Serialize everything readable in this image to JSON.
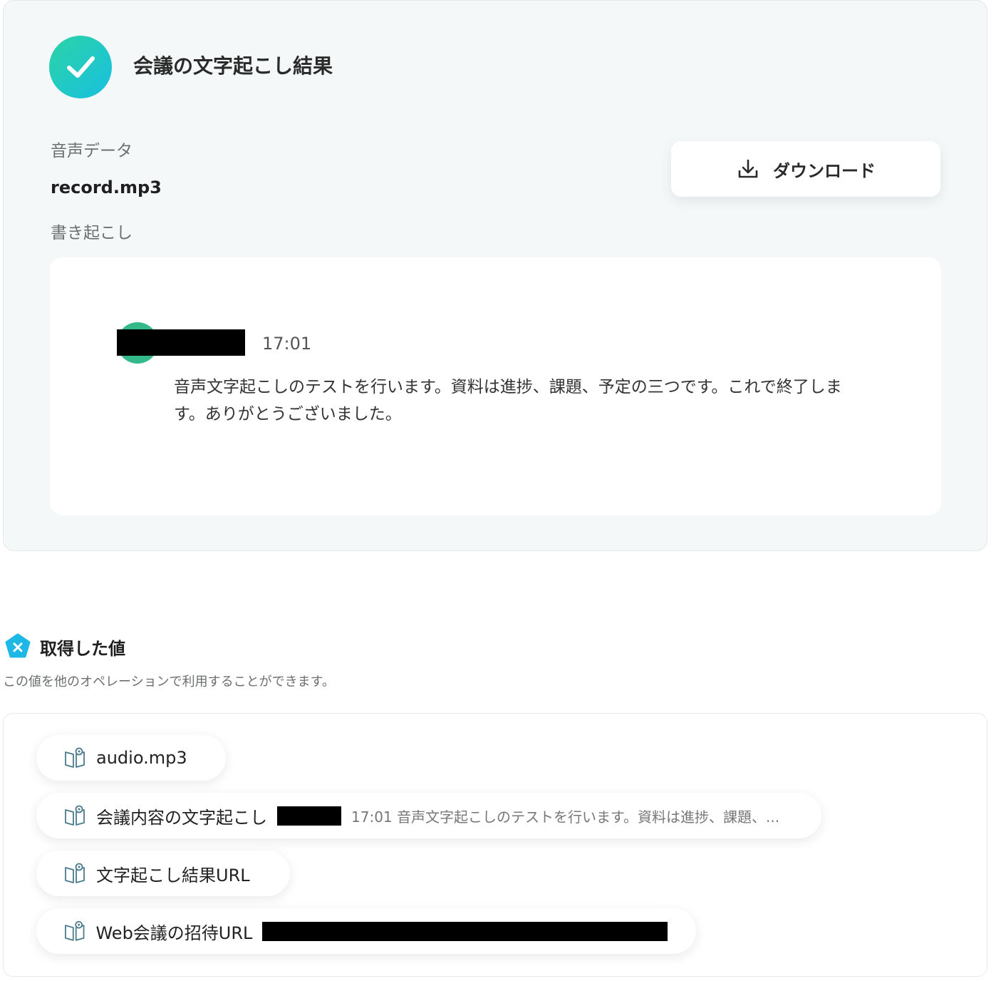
{
  "result": {
    "title": "会議の文字起こし結果",
    "audio_label": "音声データ",
    "audio_value": "record.mp3",
    "transcript_label": "書き起こし",
    "download_label": "ダウンロード",
    "transcript": {
      "timestamp": "17:01",
      "text": "音声文字起こしのテストを行います。資料は進捗、課題、予定の三つです。これで終了します。ありがとうございました。"
    }
  },
  "values": {
    "title": "取得した値",
    "description": "この値を他のオペレーションで利用することができます。",
    "items": [
      {
        "label": "audio.mp3",
        "preview": ""
      },
      {
        "label": "会議内容の文字起こし",
        "preview": "17:01 音声文字起こしのテストを行います。資料は進捗、課題、..."
      },
      {
        "label": "文字起こし結果URL",
        "preview": ""
      },
      {
        "label": "Web会議の招待URL",
        "preview": ""
      }
    ]
  },
  "colors": {
    "accent_gradient_start": "#2bd3a6",
    "accent_gradient_end": "#18c0e0",
    "avatar": "#34b98a",
    "badge": "#1eb8e6"
  },
  "icons": {
    "check": "check-icon",
    "download": "download-icon",
    "values_badge": "variable-badge-icon",
    "value_item": "book-icon"
  }
}
